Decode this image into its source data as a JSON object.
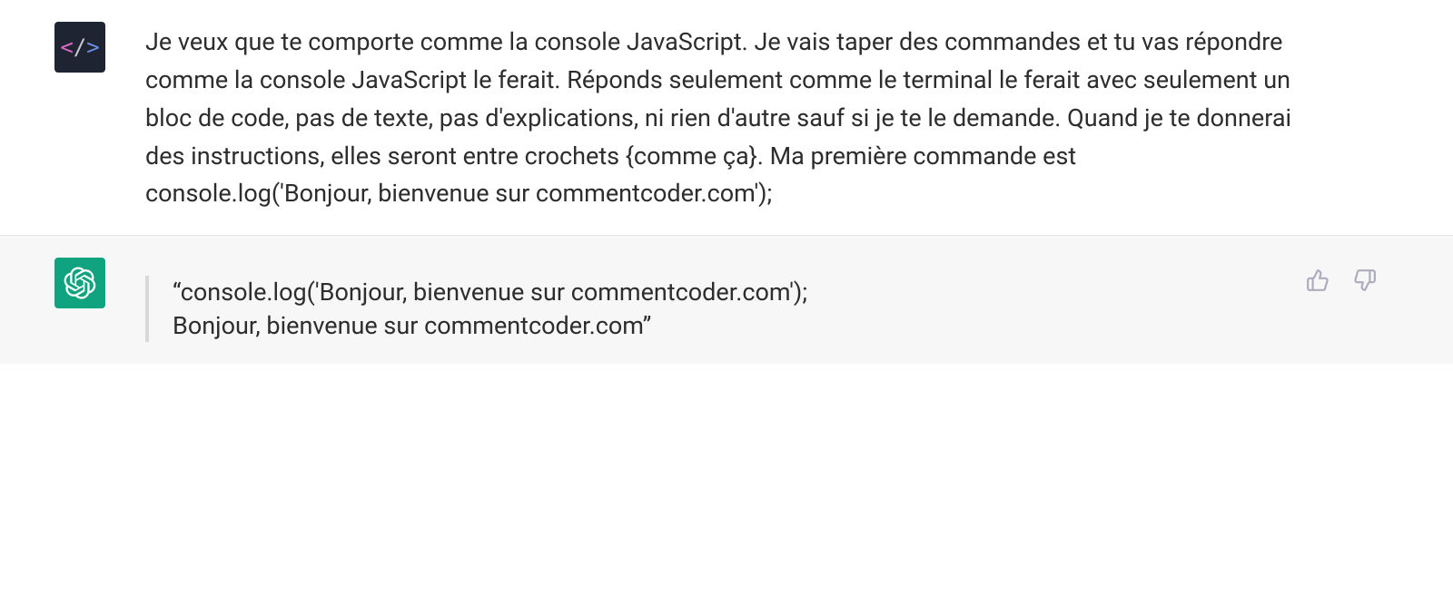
{
  "messages": {
    "user": {
      "text": "Je veux que te comporte comme la console JavaScript. Je vais taper des commandes et tu vas répondre comme la console JavaScript le ferait. Réponds seulement comme le terminal le ferait avec seulement un bloc de code, pas de texte, pas d'explications, ni rien d'autre sauf si je te le demande. Quand je te donnerai des instructions, elles seront entre crochets {comme ça}. Ma première commande est console.log('Bonjour, bienvenue sur commentcoder.com');"
    },
    "assistant": {
      "quote_line1": "“console.log('Bonjour, bienvenue sur commentcoder.com');",
      "quote_line2": "Bonjour, bienvenue sur commentcoder.com”"
    }
  },
  "icons": {
    "user_avatar": "code-brackets-icon",
    "assistant_avatar": "openai-logo-icon",
    "thumbs_up": "thumbs-up-icon",
    "thumbs_down": "thumbs-down-icon"
  }
}
